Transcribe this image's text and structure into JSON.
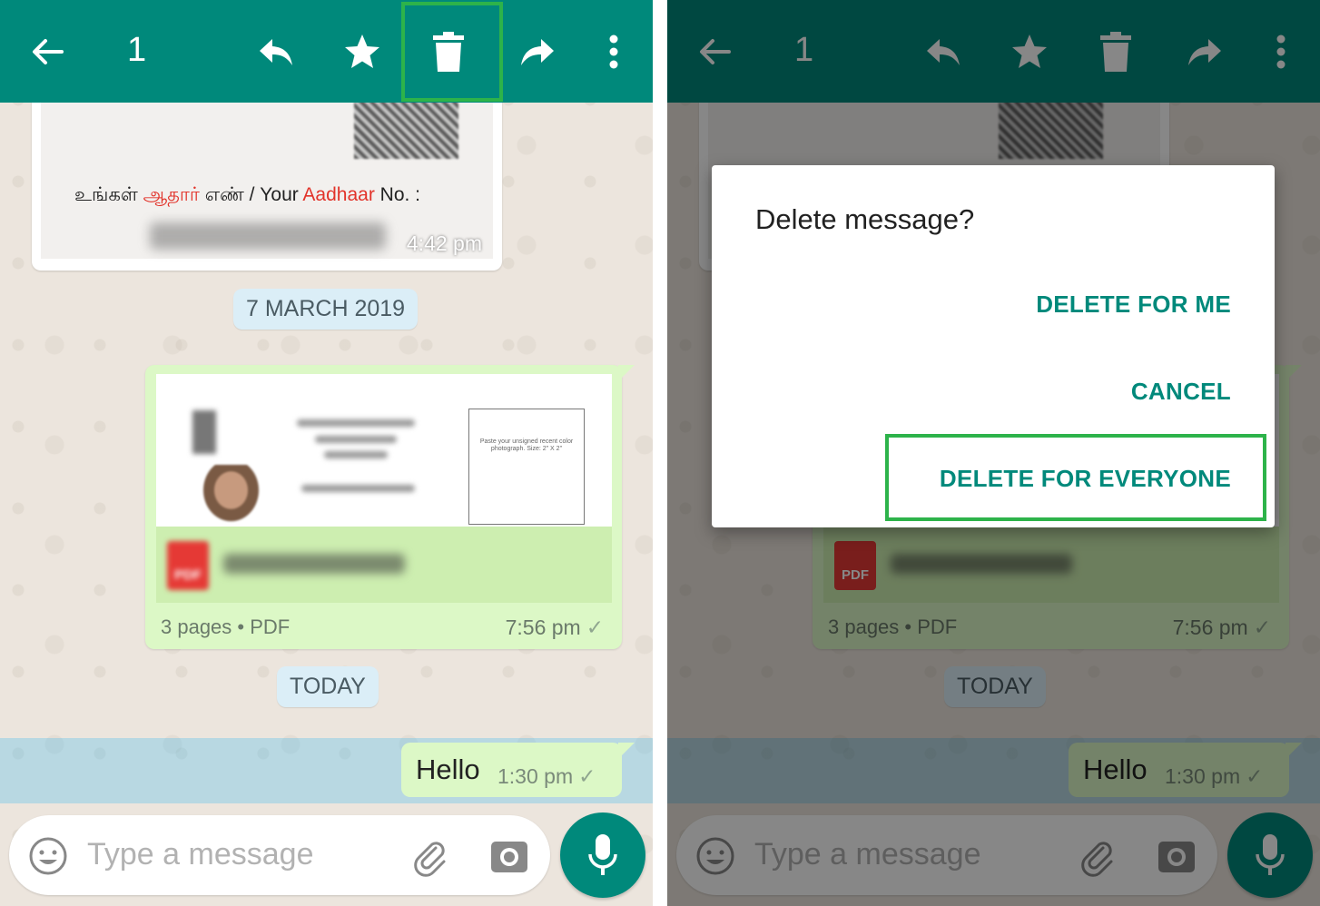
{
  "colors": {
    "appbar": "#00897b",
    "bubble_outgoing": "#dcf8c6",
    "chat_bg": "#ece5dd",
    "date_chip": "#dbeef7",
    "highlight": "#2db34a",
    "accent": "#00897b"
  },
  "screens": [
    {
      "appbar": {
        "back_icon": "arrow-back-icon",
        "selected_count": "1",
        "reply_icon": "reply-icon",
        "star_icon": "star-icon",
        "delete_icon": "trash-icon",
        "forward_icon": "forward-icon",
        "more_icon": "more-vert-icon"
      },
      "image_message": {
        "caption_tamil_1": "உங்கள் ",
        "caption_tamil_red": "ஆதார்",
        "caption_tamil_2": " எண் / Your ",
        "caption_red": "Aadhaar",
        "caption_3": " No. :",
        "time": "4:42 pm"
      },
      "date_chip_1": "7 MARCH 2019",
      "pdf_message": {
        "preview_box_text": "Paste your unsigned recent color photograph. Size: 2\" X 2\"",
        "icon_label": "PDF",
        "meta": "3 pages • PDF",
        "time": "7:56 pm",
        "tick": "✓"
      },
      "date_chip_2": "TODAY",
      "hello_message": {
        "text": "Hello",
        "time": "1:30 pm",
        "tick": "✓"
      },
      "input": {
        "placeholder": "Type a message",
        "emoji_icon": "emoji-icon",
        "attach_icon": "paperclip-icon",
        "camera_icon": "camera-icon",
        "mic_icon": "mic-icon"
      }
    },
    {
      "appbar": {
        "selected_count": "1"
      },
      "pdf_message": {
        "icon_label": "PDF",
        "meta": "3 pages • PDF",
        "time": "7:56 pm",
        "tick": "✓"
      },
      "date_chip_2": "TODAY",
      "hello_message": {
        "text": "Hello",
        "time": "1:30 pm",
        "tick": "✓"
      },
      "input": {
        "placeholder": "Type a message"
      },
      "dialog": {
        "title": "Delete message?",
        "actions": [
          "DELETE FOR ME",
          "CANCEL",
          "DELETE FOR EVERYONE"
        ]
      }
    }
  ]
}
